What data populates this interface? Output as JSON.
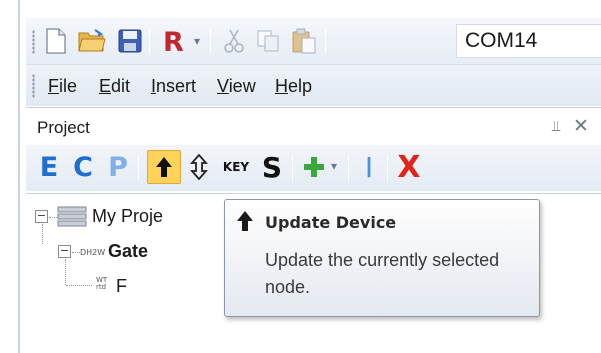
{
  "toolbar": {
    "com_port": "COM14",
    "icons": [
      "new-file-icon",
      "open-folder-icon",
      "save-icon",
      "r-icon",
      "cut-icon",
      "copy-icon",
      "paste-icon"
    ]
  },
  "menu": {
    "file": {
      "u": "F",
      "rest": "ile"
    },
    "edit": {
      "u": "E",
      "rest": "dit"
    },
    "insert": {
      "u": "I",
      "rest": "nsert"
    },
    "view": {
      "u": "V",
      "rest": "iew"
    },
    "help": {
      "u": "H",
      "rest": "elp"
    }
  },
  "panel": {
    "title": "Project",
    "toolbar_labels": {
      "e": "E",
      "c": "C",
      "p": "P",
      "key": "KEY",
      "s": "S",
      "i": "I",
      "x": "X"
    },
    "colors": {
      "blue": "#1f6fd1",
      "faded_blue": "#7fb0ea",
      "red": "#e0241b",
      "green": "#3aa83a",
      "active_bg": "#ffd35a"
    }
  },
  "tree": {
    "root_label": "My Proje",
    "gateway_tag": "DH2W",
    "gateway_label": "Gate",
    "child_tag_top": "WT",
    "child_tag_bottom": "rtd",
    "child_label": "F"
  },
  "tooltip": {
    "title": "Update Device",
    "body": "Update the currently selected node."
  }
}
